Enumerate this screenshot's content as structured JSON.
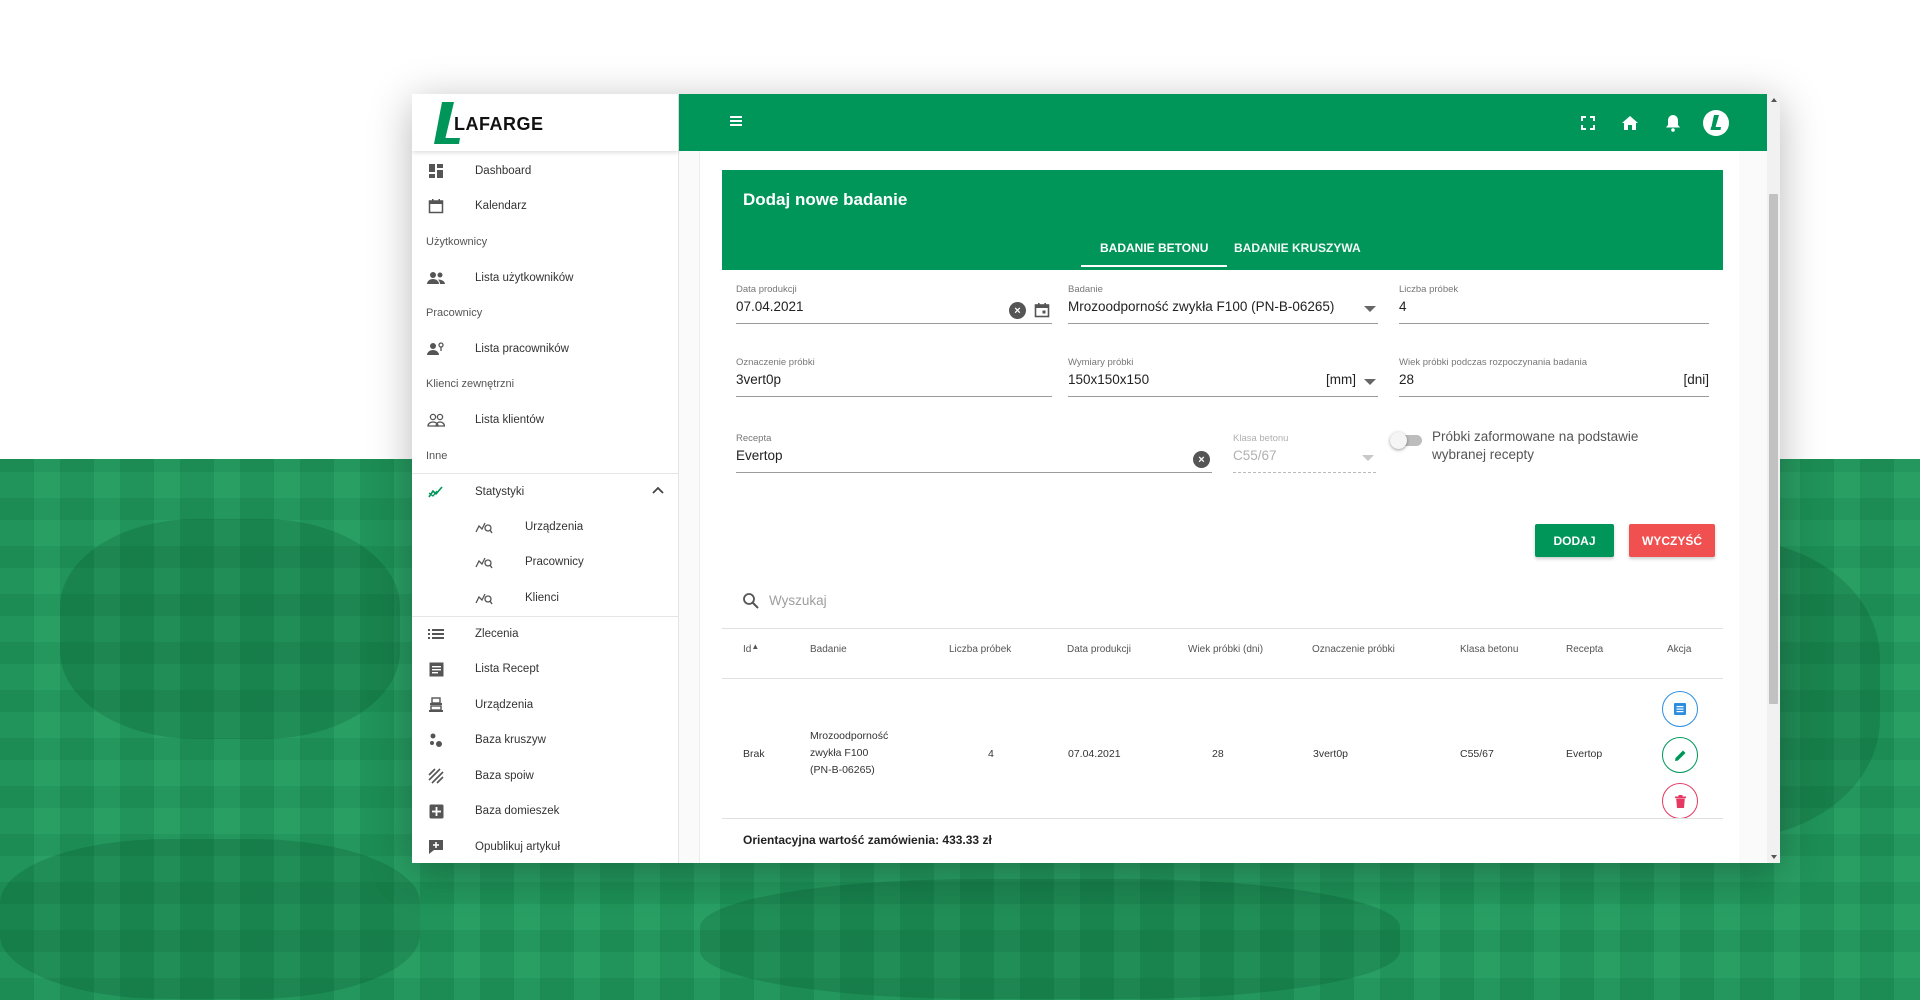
{
  "brand": {
    "name": "LAFARGE",
    "green": "#00965a",
    "danger": "#f0504f"
  },
  "sidebar": {
    "items": [
      {
        "type": "item",
        "label": "Dashboard",
        "icon": "dashboard-icon"
      },
      {
        "type": "item",
        "label": "Kalendarz",
        "icon": "calendar-icon"
      },
      {
        "type": "section",
        "label": "Użytkownicy"
      },
      {
        "type": "item",
        "label": "Lista użytkowników",
        "icon": "users-icon"
      },
      {
        "type": "section",
        "label": "Pracownicy"
      },
      {
        "type": "item",
        "label": "Lista pracowników",
        "icon": "worker-icon"
      },
      {
        "type": "section",
        "label": "Klienci zewnętrzni"
      },
      {
        "type": "item",
        "label": "Lista klientów",
        "icon": "clients-icon"
      },
      {
        "type": "section",
        "label": "Inne"
      },
      {
        "type": "item",
        "label": "Statystyki",
        "icon": "stats-icon",
        "expanded": true
      },
      {
        "type": "sub",
        "label": "Urządzenia",
        "icon": "stats-search-icon"
      },
      {
        "type": "sub",
        "label": "Pracownicy",
        "icon": "stats-search-icon"
      },
      {
        "type": "sub",
        "label": "Klienci",
        "icon": "stats-search-icon"
      },
      {
        "type": "item",
        "label": "Zlecenia",
        "icon": "list-icon"
      },
      {
        "type": "item",
        "label": "Lista Recept",
        "icon": "document-icon"
      },
      {
        "type": "item",
        "label": "Urządzenia",
        "icon": "device-icon"
      },
      {
        "type": "item",
        "label": "Baza kruszyw",
        "icon": "aggregate-icon"
      },
      {
        "type": "item",
        "label": "Baza spoiw",
        "icon": "binder-icon"
      },
      {
        "type": "item",
        "label": "Baza domieszek",
        "icon": "plus-box-icon"
      },
      {
        "type": "item",
        "label": "Opublikuj artykuł",
        "icon": "publish-icon"
      }
    ]
  },
  "form": {
    "title": "Dodaj nowe badanie",
    "tabs": [
      "BADANIE BETONU",
      "BADANIE KRUSZYWA"
    ],
    "active_tab": 0,
    "data_produkcji": {
      "label": "Data produkcji",
      "value": "07.04.2021"
    },
    "badanie": {
      "label": "Badanie",
      "value": "Mrozoodporność zwykła F100 (PN-B-06265)"
    },
    "liczba_probek": {
      "label": "Liczba próbek",
      "value": "4"
    },
    "oznaczenie": {
      "label": "Oznaczenie próbki",
      "value": "3vert0p"
    },
    "wymiary": {
      "label": "Wymiary próbki",
      "value": "150x150x150",
      "unit": "[mm]"
    },
    "wiek": {
      "label": "Wiek próbki podczas rozpoczynania badania",
      "value": "28",
      "unit": "[dni]"
    },
    "recepta": {
      "label": "Recepta",
      "value": "Evertop"
    },
    "klasa": {
      "label": "Klasa betonu",
      "value": "C55/67"
    },
    "toggle_label": "Próbki zaformowane na podstawie wybranej recepty",
    "add_label": "DODAJ",
    "clear_label": "WYCZYŚĆ"
  },
  "search": {
    "placeholder": "Wyszukaj"
  },
  "table": {
    "headers": [
      "Id",
      "Badanie",
      "Liczba próbek",
      "Data produkcji",
      "Wiek próbki (dni)",
      "Oznaczenie próbki",
      "Klasa betonu",
      "Recepta",
      "Akcja"
    ],
    "rows": [
      {
        "id": "Brak",
        "badanie_l1": "Mrozoodporność",
        "badanie_l2": "zwykła F100",
        "badanie_l3": "(PN-B-06265)",
        "liczba": "4",
        "data": "07.04.2021",
        "wiek": "28",
        "oznaczenie": "3vert0p",
        "klasa": "C55/67",
        "recepta": "Evertop"
      }
    ]
  },
  "total": "Orientacyjna wartość zamówienia: 433.33 zł"
}
